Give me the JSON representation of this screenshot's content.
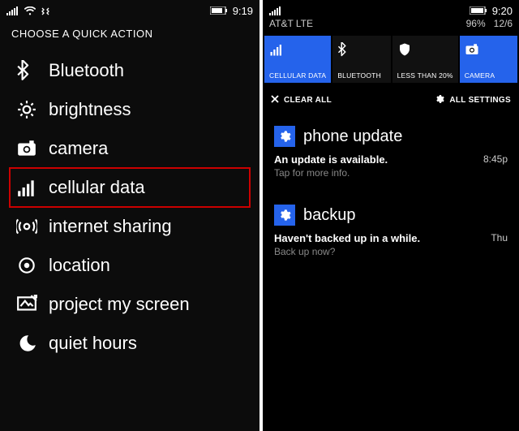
{
  "left": {
    "status": {
      "time": "9:19"
    },
    "heading": "CHOOSE A QUICK ACTION",
    "items": [
      {
        "icon": "bluetooth-icon",
        "label": "Bluetooth",
        "highlight": false
      },
      {
        "icon": "brightness-icon",
        "label": "brightness",
        "highlight": false
      },
      {
        "icon": "camera-icon",
        "label": "camera",
        "highlight": false
      },
      {
        "icon": "cellular-icon",
        "label": "cellular data",
        "highlight": true
      },
      {
        "icon": "internet-sharing-icon",
        "label": "internet sharing",
        "highlight": false
      },
      {
        "icon": "location-icon",
        "label": "location",
        "highlight": false
      },
      {
        "icon": "project-screen-icon",
        "label": "project my screen",
        "highlight": false
      },
      {
        "icon": "quiet-hours-icon",
        "label": "quiet hours",
        "highlight": false
      }
    ]
  },
  "right": {
    "status": {
      "time": "9:20",
      "carrier": "AT&T LTE",
      "battery_pct": "96%",
      "date": "12/6"
    },
    "tiles": [
      {
        "icon": "cellular-icon",
        "label": "CELLULAR DATA",
        "active": true
      },
      {
        "icon": "bluetooth-icon",
        "label": "BLUETOOTH",
        "active": false
      },
      {
        "icon": "shield-icon",
        "label": "LESS THAN 20%",
        "active": false
      },
      {
        "icon": "camera-icon",
        "label": "CAMERA",
        "active": true
      }
    ],
    "actionbar": {
      "clear": "CLEAR ALL",
      "settings": "ALL SETTINGS"
    },
    "notifications": [
      {
        "app": "phone update",
        "title": "An update is available.",
        "sub": "Tap for more info.",
        "ts": "8:45p"
      },
      {
        "app": "backup",
        "title": "Haven't backed up in a while.",
        "sub": "Back up now?",
        "ts": "Thu"
      }
    ]
  }
}
